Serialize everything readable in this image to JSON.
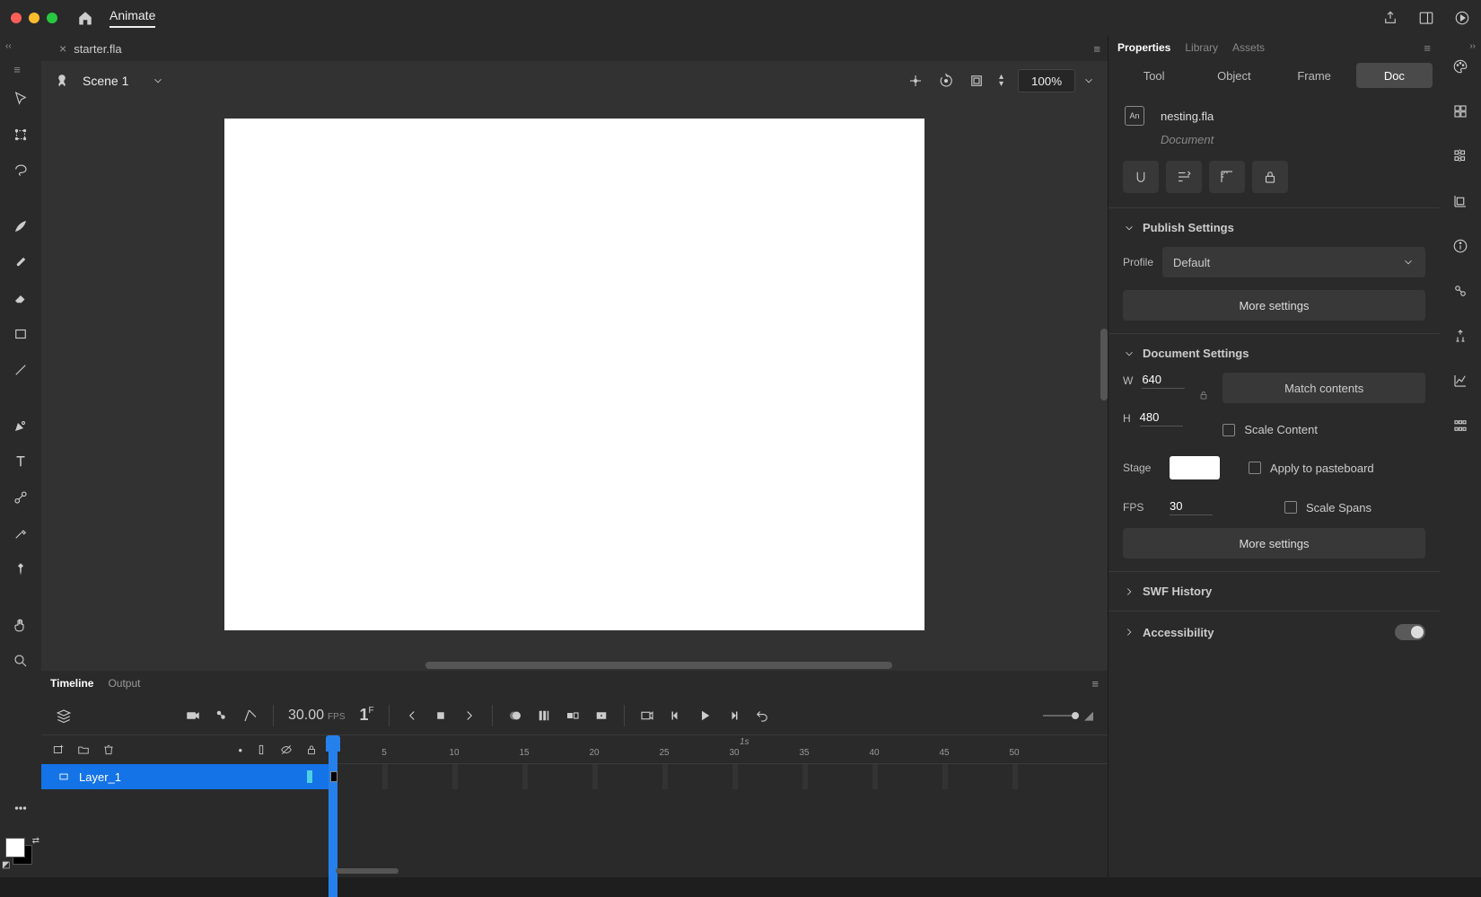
{
  "app": {
    "name": "Animate"
  },
  "file_tab": {
    "name": "starter.fla"
  },
  "scene": {
    "name": "Scene 1",
    "zoom": "100%"
  },
  "timeline": {
    "tabs": [
      "Timeline",
      "Output"
    ],
    "fps": "30.00",
    "fps_label": "FPS",
    "frame": "1",
    "frame_suffix": "F",
    "ruler_marks": [
      "5",
      "10",
      "15",
      "20",
      "25",
      "30",
      "35",
      "40",
      "45",
      "50"
    ],
    "ruler_1s": "1s",
    "layer": {
      "name": "Layer_1"
    }
  },
  "props": {
    "tabs": [
      "Properties",
      "Library",
      "Assets"
    ],
    "context_tabs": [
      "Tool",
      "Object",
      "Frame",
      "Doc"
    ],
    "doc": {
      "filename": "nesting.fla",
      "subtitle": "Document"
    },
    "publish": {
      "title": "Publish Settings",
      "profile_label": "Profile",
      "profile_value": "Default",
      "more_btn": "More settings"
    },
    "docset": {
      "title": "Document Settings",
      "w_label": "W",
      "w_value": "640",
      "h_label": "H",
      "h_value": "480",
      "match_btn": "Match contents",
      "scale_content": "Scale Content",
      "stage_label": "Stage",
      "apply_pasteboard": "Apply to pasteboard",
      "fps_label": "FPS",
      "fps_value": "30",
      "scale_spans": "Scale Spans",
      "more_btn": "More settings"
    },
    "swf": {
      "title": "SWF History"
    },
    "a11y": {
      "title": "Accessibility"
    }
  }
}
